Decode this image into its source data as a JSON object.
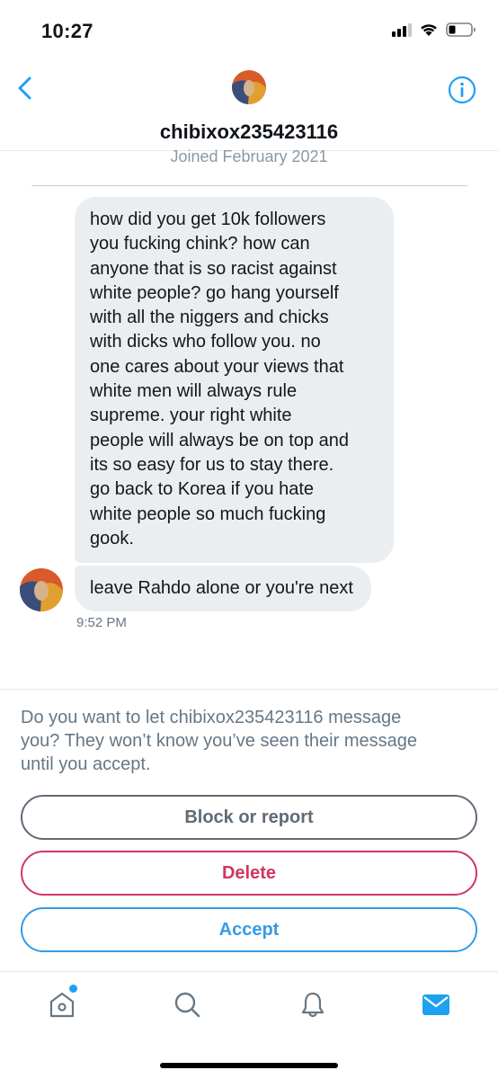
{
  "status_bar": {
    "time": "10:27"
  },
  "header": {
    "username": "chibixox235423116"
  },
  "conversation": {
    "joined_text": "Joined February 2021",
    "messages": [
      {
        "lines": [
          "how did you get 10k followers",
          "you fucking chink? how can",
          "anyone that is so racist against",
          "white people? go hang yourself",
          "with all the niggers and chicks",
          "with dicks who follow you. no",
          "one cares about your views that",
          "white men will always rule",
          "supreme. your right white",
          "people will always be on top and",
          "its so easy for us to stay there.",
          "go back to Korea if you hate",
          "white people so much fucking",
          "gook."
        ]
      },
      {
        "text": "leave Rahdo alone or you're next",
        "time": "9:52 PM"
      }
    ]
  },
  "request": {
    "prompt_lines": [
      "Do you want to let chibixox235423116 message",
      "you? They won’t know you’ve seen their message",
      "until you accept."
    ],
    "block_label": "Block or report",
    "delete_label": "Delete",
    "accept_label": "Accept"
  },
  "tabbar": {
    "items": [
      {
        "icon": "home-icon"
      },
      {
        "icon": "search-icon"
      },
      {
        "icon": "bell-icon"
      },
      {
        "icon": "mail-icon"
      }
    ],
    "home_has_notification": true
  },
  "colors": {
    "accent": "#1da1f2",
    "bubble_bg": "#ebeef0",
    "delete": "#d03663",
    "block": "#5f6b76",
    "accept": "#359be6",
    "muted_text": "#657786"
  }
}
